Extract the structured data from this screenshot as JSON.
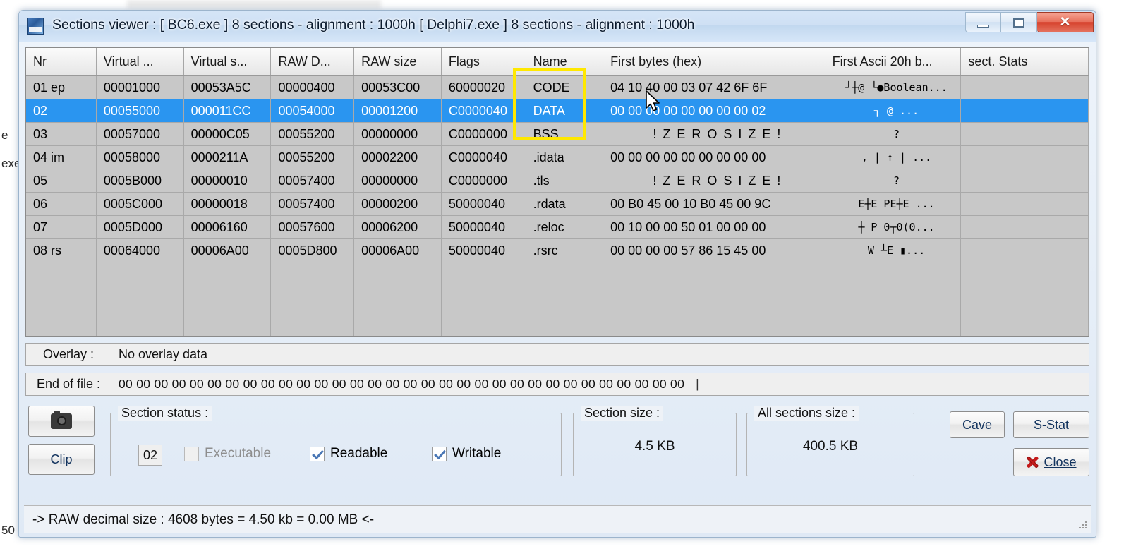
{
  "window": {
    "title": "Sections viewer :  [ BC6.exe ] 8 sections - alignment : 1000h [ Delphi7.exe ] 8 sections - alignment : 1000h",
    "icon_label": "bc1",
    "minimize_label": "",
    "maximize_label": "",
    "close_label": "✕"
  },
  "grid": {
    "headers": [
      "Nr",
      "Virtual ...",
      "Virtual s...",
      "RAW D...",
      "RAW size",
      "Flags",
      "Name",
      "First bytes (hex)",
      "First Ascii 20h b...",
      "sect. Stats"
    ],
    "rows": [
      {
        "nr": "01 ep",
        "virtual_address": "00001000",
        "virtual_size": "00053A5C",
        "raw_data": "00000400",
        "raw_size": "00053C00",
        "flags": "60000020",
        "name": "CODE",
        "first_bytes": "04 10 40 00 03 07 42 6F 6F",
        "first_ascii": "┘┼@ └●Boolean...",
        "stats": "",
        "selected": false,
        "zero": false
      },
      {
        "nr": "02",
        "virtual_address": "00055000",
        "virtual_size": "000011CC",
        "raw_data": "00054000",
        "raw_size": "00001200",
        "flags": "C0000040",
        "name": "DATA",
        "first_bytes": "00 00 00 00 00 00 00 00 02",
        "first_ascii": "┐ @      ...",
        "stats": "",
        "selected": true,
        "zero": false
      },
      {
        "nr": "03",
        "virtual_address": "00057000",
        "virtual_size": "00000C05",
        "raw_data": "00055200",
        "raw_size": "00000000",
        "flags": "C0000000",
        "name": "BSS",
        "first_bytes": "! Z E R O   S I Z E !",
        "first_ascii": "?",
        "stats": "",
        "selected": false,
        "zero": true
      },
      {
        "nr": "04 im",
        "virtual_address": "00058000",
        "virtual_size": "0000211A",
        "raw_data": "00055200",
        "raw_size": "00002200",
        "flags": "C0000040",
        "name": ".idata",
        "first_bytes": "00 00 00 00 00 00 00 00 00",
        "first_ascii": ", | ↑ |  ...",
        "stats": "",
        "selected": false,
        "zero": false
      },
      {
        "nr": "05",
        "virtual_address": "0005B000",
        "virtual_size": "00000010",
        "raw_data": "00057400",
        "raw_size": "00000000",
        "flags": "C0000000",
        "name": ".tls",
        "first_bytes": "! Z E R O   S I Z E !",
        "first_ascii": "?",
        "stats": "",
        "selected": false,
        "zero": true
      },
      {
        "nr": "06",
        "virtual_address": "0005C000",
        "virtual_size": "00000018",
        "raw_data": "00057400",
        "raw_size": "00000200",
        "flags": "50000040",
        "name": ".rdata",
        "first_bytes": "00 B0 45 00 10 B0 45 00 9C",
        "first_ascii": "E┼E PE┼E  ...",
        "stats": "",
        "selected": false,
        "zero": false
      },
      {
        "nr": "07",
        "virtual_address": "0005D000",
        "virtual_size": "00006160",
        "raw_data": "00057600",
        "raw_size": "00006200",
        "flags": "50000040",
        "name": ".reloc",
        "first_bytes": "00 10 00 00 50 01 00 00 00",
        "first_ascii": "┼ P    0┬0(0...",
        "stats": "",
        "selected": false,
        "zero": false
      },
      {
        "nr": "08 rs",
        "virtual_address": "00064000",
        "virtual_size": "00006A00",
        "raw_data": "0005D800",
        "raw_size": "00006A00",
        "flags": "50000040",
        "name": ".rsrc",
        "first_bytes": "00 00 00 00 57 86 15 45 00",
        "first_ascii": "W ┴E   ▮...",
        "stats": "",
        "selected": false,
        "zero": false
      }
    ],
    "highlight_color": "#ffe800",
    "selection_color": "#2a95f0"
  },
  "overlay": {
    "label": "Overlay :",
    "value": "No overlay data"
  },
  "end_of_file": {
    "label": "End of file :",
    "value": "00 00 00 00 00 00 00 00 00 00 00 00 00 00 00 00 00 00 00 00 00 00 00 00 00 00 00 00 00 00 00 00",
    "caret": "|"
  },
  "bottom": {
    "snapshot_button": "",
    "snapshot_icon": "camera-icon",
    "clip_button": "Clip",
    "section_status": {
      "legend": "Section status :",
      "section_number": "02",
      "checkboxes": [
        {
          "label": "Executable",
          "checked": false,
          "enabled": false
        },
        {
          "label": "Readable",
          "checked": true,
          "enabled": true
        },
        {
          "label": "Writable",
          "checked": true,
          "enabled": true
        }
      ]
    },
    "section_size": {
      "legend": "Section size :",
      "value": "4.5 KB"
    },
    "all_sections_size": {
      "legend": "All sections size :",
      "value": "400.5 KB"
    },
    "cave_button": "Cave",
    "sstat_button": "S-Stat",
    "close_button": "Close"
  },
  "statusbar": {
    "text": "-> RAW decimal size :     4608 bytes  =   4.50 kb  = 0.00 MB <-"
  },
  "background": {
    "left_fragments": [
      "e",
      "exe",
      "50"
    ]
  }
}
